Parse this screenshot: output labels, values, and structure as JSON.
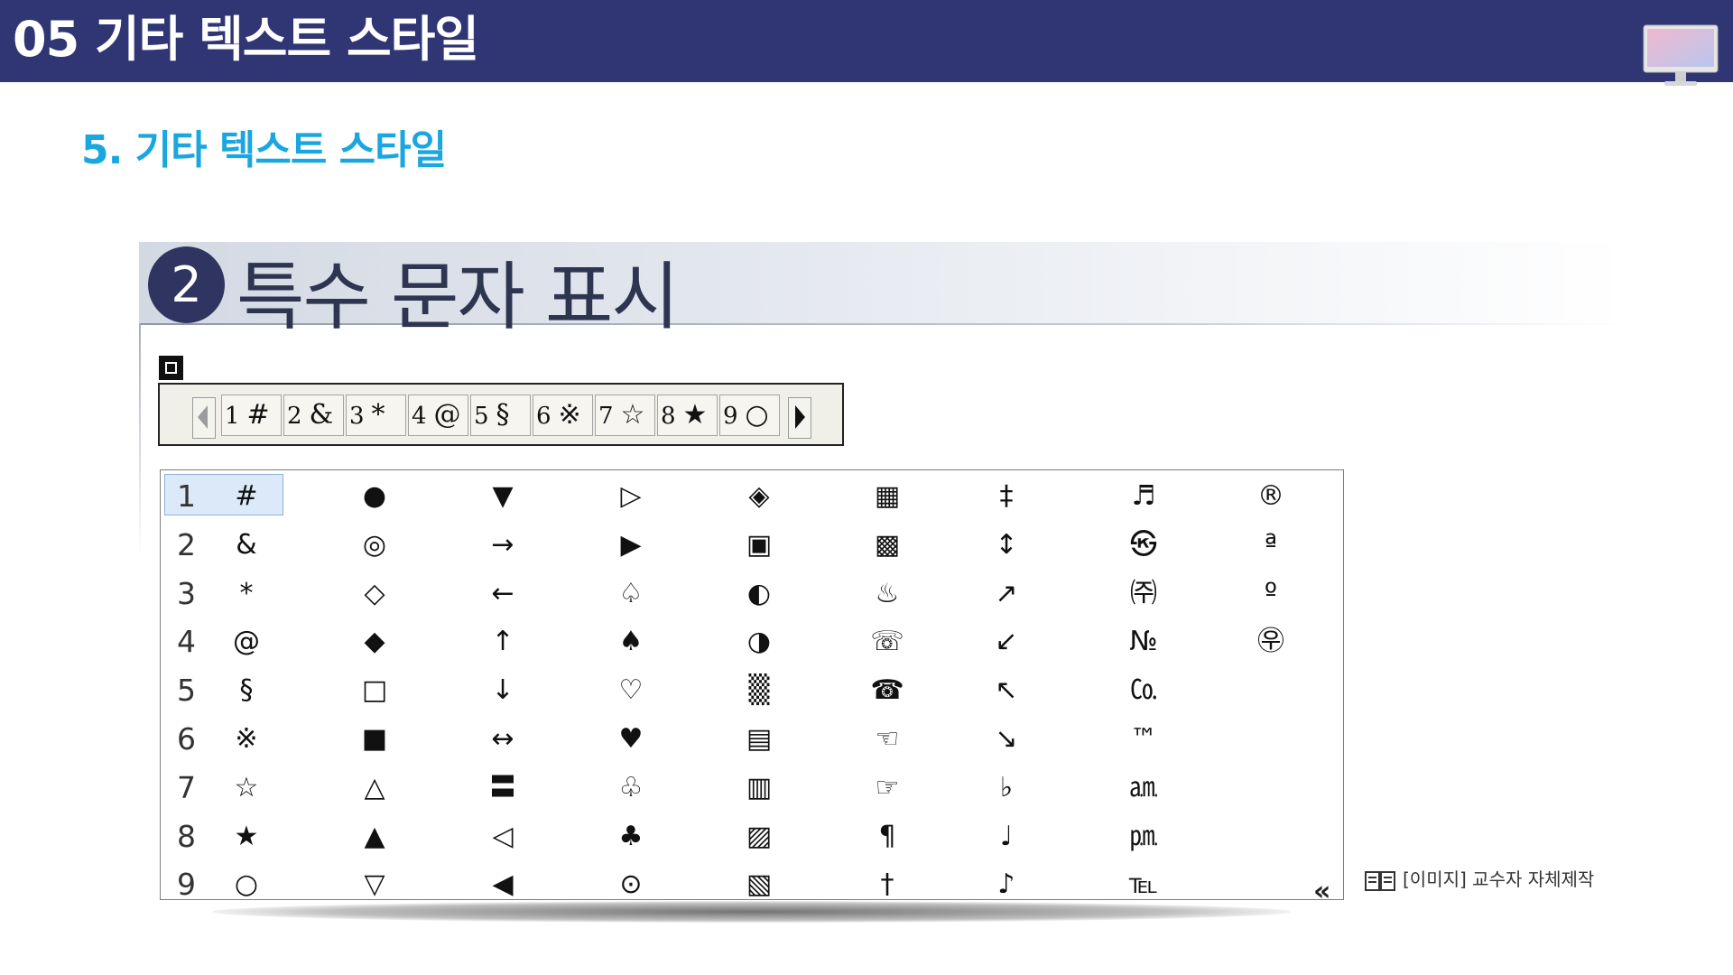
{
  "header": {
    "title": "05 기타 텍스트 스타일"
  },
  "subtitle": "5. 기타 텍스트 스타일",
  "section": {
    "number": "2",
    "title": "특수 문자 표시"
  },
  "toolbar": {
    "cells": [
      {
        "num": "1",
        "sym": "#"
      },
      {
        "num": "2",
        "sym": "&"
      },
      {
        "num": "3",
        "sym": "*"
      },
      {
        "num": "4",
        "sym": "@"
      },
      {
        "num": "5",
        "sym": "§"
      },
      {
        "num": "6",
        "sym": "※"
      },
      {
        "num": "7",
        "sym": "☆"
      },
      {
        "num": "8",
        "sym": "★"
      },
      {
        "num": "9",
        "sym": "○"
      }
    ]
  },
  "grid": {
    "row_numbers": [
      "1",
      "2",
      "3",
      "4",
      "5",
      "6",
      "7",
      "8",
      "9"
    ],
    "columns": [
      [
        "#",
        "&",
        "*",
        "@",
        "§",
        "※",
        "☆",
        "★",
        "○"
      ],
      [
        "●",
        "◎",
        "◇",
        "◆",
        "□",
        "■",
        "△",
        "▲",
        "▽"
      ],
      [
        "▼",
        "→",
        "←",
        "↑",
        "↓",
        "↔",
        "〓",
        "◁",
        "◀"
      ],
      [
        "▷",
        "▶",
        "♤",
        "♠",
        "♡",
        "♥",
        "♧",
        "♣",
        "⊙"
      ],
      [
        "◈",
        "▣",
        "◐",
        "◑",
        "▒",
        "▤",
        "▥",
        "▨",
        "▧"
      ],
      [
        "▦",
        "▩",
        "♨",
        "☏",
        "☎",
        "☜",
        "☞",
        "¶",
        "†"
      ],
      [
        "‡",
        "↕",
        "↗",
        "↙",
        "↖",
        "↘",
        "♭",
        "♩",
        "♪"
      ],
      [
        "♬",
        "㉿",
        "㈜",
        "№",
        "㏇",
        "™",
        "㏂",
        "㏘",
        "℡"
      ],
      [
        "®",
        "ª",
        "º",
        "㉾",
        "",
        "",
        "",
        "",
        ""
      ]
    ],
    "collapse_label": "«"
  },
  "caption": "[이미지] 교수자 자체제작",
  "icons": [
    "monitor-icon",
    "book-icon",
    "left-arrow-icon",
    "right-arrow-icon",
    "square-icon"
  ],
  "colors": {
    "header_bg": "#303573",
    "subtitle": "#1aa7e0",
    "badge": "#2f3560"
  }
}
